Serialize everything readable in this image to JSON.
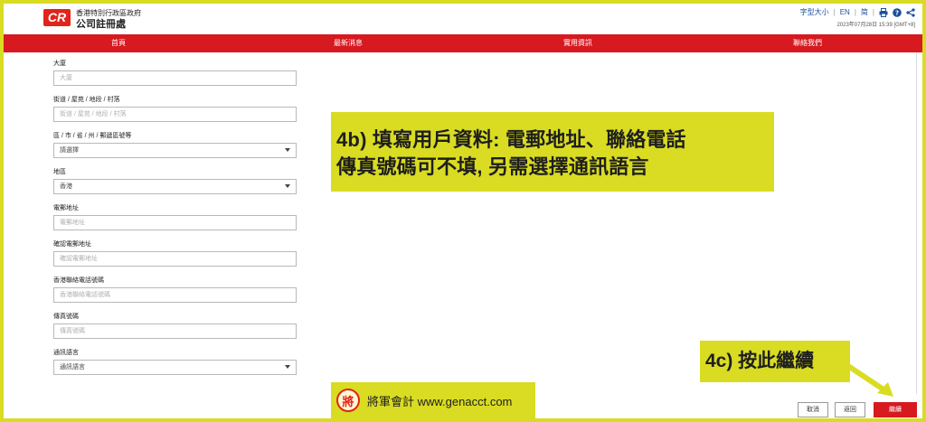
{
  "header": {
    "logo_text": "CR",
    "org_line1": "香港特別行政區政府",
    "org_line2": "公司註冊處",
    "font_size_label": "字型大小",
    "lang_en": "EN",
    "lang_sc": "简",
    "timestamp": "2023年07月28日 15:39 [GMT+8]"
  },
  "icons": {
    "print": "print-icon",
    "help": "help-icon",
    "share": "share-icon",
    "dropdown": "chevron-down-icon"
  },
  "nav": {
    "items": [
      {
        "label": "首頁"
      },
      {
        "label": "最新消息"
      },
      {
        "label": "實用資訊"
      },
      {
        "label": "聯絡我們"
      }
    ]
  },
  "form": {
    "building": {
      "label": "大廈",
      "placeholder": "大廈"
    },
    "street": {
      "label": "街道 / 屋苑 / 地段 / 村落",
      "placeholder": "街道 / 屋苑 / 地段 / 村落"
    },
    "district": {
      "label": "區 / 市 / 省 / 州 / 郵遞區號等",
      "value": "請選擇"
    },
    "region": {
      "label": "地區",
      "value": "香港"
    },
    "email": {
      "label": "電郵地址",
      "placeholder": "電郵地址"
    },
    "confirm_email": {
      "label": "確認電郵地址",
      "placeholder": "確認電郵地址"
    },
    "phone": {
      "label": "香港聯絡電話號碼",
      "placeholder": "香港聯絡電話號碼"
    },
    "fax": {
      "label": "傳真號碼",
      "placeholder": "傳真號碼"
    },
    "language": {
      "label": "通訊語言",
      "value": "通訊語言"
    }
  },
  "callouts": {
    "step4b_line1": "4b) 填寫用戶資料: 電郵地址、聯絡電話",
    "step4b_line2": "傳真號碼可不填, 另需選擇通訊語言",
    "step4c": "4c) 按此繼續"
  },
  "watermark": {
    "seal_char": "將",
    "text": "將軍會計 www.genacct.com"
  },
  "buttons": {
    "cancel": "取消",
    "back": "返回",
    "next": "繼續"
  },
  "colors": {
    "brand_red": "#d71920",
    "highlight_yellow": "#d9dc22",
    "link_blue": "#1a4f9c"
  }
}
